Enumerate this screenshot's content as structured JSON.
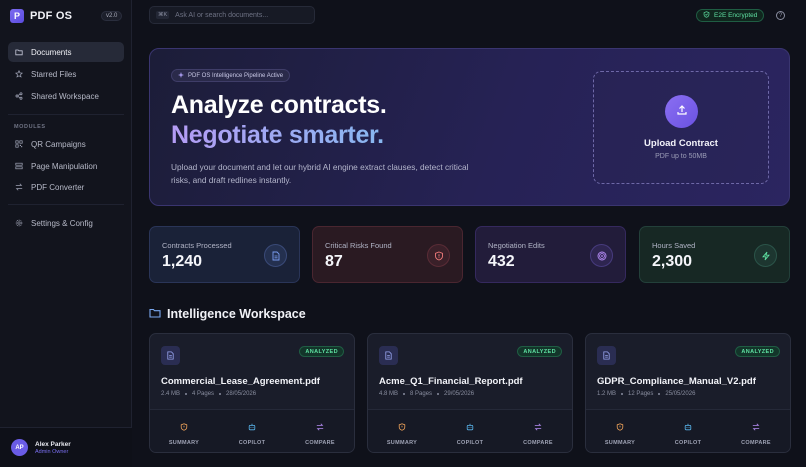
{
  "app": {
    "name": "PDF OS",
    "logo_letter": "P",
    "version": "v2.0"
  },
  "sidebar": {
    "items": [
      {
        "label": "Documents",
        "icon": "folder-icon",
        "active": true
      },
      {
        "label": "Starred Files",
        "icon": "star-icon"
      },
      {
        "label": "Shared Workspace",
        "icon": "share-icon"
      }
    ],
    "modules_label": "MODULES",
    "modules": [
      {
        "label": "QR Campaigns",
        "icon": "qr-icon"
      },
      {
        "label": "Page Manipulation",
        "icon": "pages-icon"
      },
      {
        "label": "PDF Converter",
        "icon": "convert-icon"
      }
    ],
    "settings": {
      "label": "Settings & Config",
      "icon": "gear-icon"
    },
    "user": {
      "initials": "AP",
      "name": "Alex Parker",
      "role": "Admin Owner"
    }
  },
  "topbar": {
    "search_kbd": "⌘K",
    "search_placeholder": "Ask AI or search documents...",
    "encryption_badge": "E2E Encrypted",
    "help_icon": "?"
  },
  "hero": {
    "pill": "PDF OS Intelligence Pipeline Active",
    "headline_1": "Analyze contracts.",
    "headline_2": "Negotiate smarter.",
    "description": "Upload your document and let our hybrid AI engine extract clauses, detect critical risks, and draft redlines instantly.",
    "upload_title": "Upload Contract",
    "upload_sub": "PDF up to 50MB"
  },
  "stats": [
    {
      "label": "Contracts Processed",
      "value": "1,240",
      "icon": "document-icon",
      "color": "#7a9cf0"
    },
    {
      "label": "Critical Risks Found",
      "value": "87",
      "icon": "shield-alert-icon",
      "color": "#f07a7a"
    },
    {
      "label": "Negotiation Edits",
      "value": "432",
      "icon": "target-icon",
      "color": "#b58cf5"
    },
    {
      "label": "Hours Saved",
      "value": "2,300",
      "icon": "bolt-icon",
      "color": "#5ee0a1"
    }
  ],
  "workspace": {
    "title": "Intelligence Workspace",
    "cards": [
      {
        "badge": "ANALYZED",
        "name": "Commercial_Lease_Agreement.pdf",
        "size": "2.4 MB",
        "pages": "4 Pages",
        "date": "28/05/2026"
      },
      {
        "badge": "ANALYZED",
        "name": "Acme_Q1_Financial_Report.pdf",
        "size": "4.8 MB",
        "pages": "8 Pages",
        "date": "29/05/2026"
      },
      {
        "badge": "ANALYZED",
        "name": "GDPR_Compliance_Manual_V2.pdf",
        "size": "1.2 MB",
        "pages": "12 Pages",
        "date": "25/05/2026"
      }
    ],
    "actions": {
      "summary": "SUMMARY",
      "copilot": "COPILOT",
      "compare": "COMPARE"
    }
  }
}
